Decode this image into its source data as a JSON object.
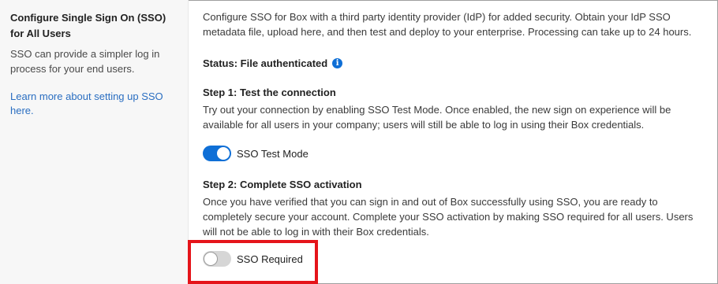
{
  "left": {
    "title": "Configure Single Sign On (SSO) for All Users",
    "description": "SSO can provide a simpler log in process for your end users.",
    "learn_more_link": "Learn more about setting up SSO here."
  },
  "main": {
    "intro": "Configure SSO for Box with a third party identity provider (IdP) for added security. Obtain your IdP SSO metadata file, upload here, and then test and deploy to your enterprise. Processing can take up to 24 hours.",
    "status": "Status: File authenticated",
    "step1": {
      "heading": "Step 1: Test the connection",
      "text": "Try out your connection by enabling SSO Test Mode. Once enabled, the new sign on experience will be available for all users in your company; users will still be able to log in using their Box credentials.",
      "toggle_label": "SSO Test Mode",
      "toggle_on": true
    },
    "step2": {
      "heading": "Step 2: Complete SSO activation",
      "text": "Once you have verified that you can sign in and out of Box successfully using SSO, you are ready to completely secure your account. Complete your SSO activation by making SSO required for all users. Users will not be able to log in with their Box credentials.",
      "toggle_label": "SSO Required",
      "toggle_on": false
    }
  },
  "colors": {
    "accent": "#0f6fd6",
    "link": "#2a6ec1",
    "highlight_border": "#e5141a"
  },
  "icons": {
    "status_info": "info-icon"
  }
}
